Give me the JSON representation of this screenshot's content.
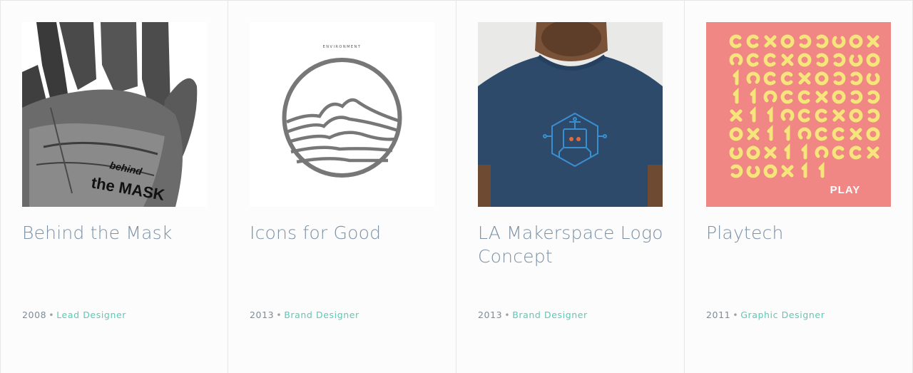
{
  "projects": [
    {
      "title": "Behind the Mask",
      "year": "2008",
      "separator": "•",
      "role": "Lead Designer",
      "image_text_1": "behind",
      "image_text_2": "the MASK",
      "image_icon": "hand-icon"
    },
    {
      "title": "Icons for Good",
      "year": "2013",
      "separator": "•",
      "role": "Brand Designer",
      "image_text": "ENVIRONMENT",
      "image_icon": "mountain-circle-icon"
    },
    {
      "title": "LA Makerspace Logo Concept",
      "year": "2013",
      "separator": "•",
      "role": "Brand Designer",
      "image_icon": "robot-hexagon-icon"
    },
    {
      "title": "Playtech",
      "year": "2011",
      "separator": "•",
      "role": "Graphic Designer",
      "image_text": "PLAY",
      "image_icon": "play-pattern-icon"
    }
  ],
  "colors": {
    "title": "#7c90a5",
    "role": "#5fc7b5",
    "playtech_bg": "#f08784",
    "playtech_glyph": "#f5e57a",
    "shirt": "#2e4a6b",
    "makerspace_logo": "#3a8fd0"
  }
}
